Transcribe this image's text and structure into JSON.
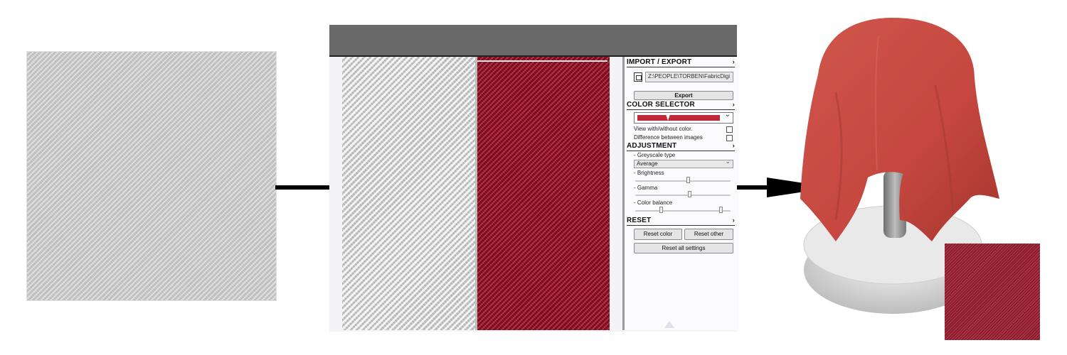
{
  "import_export": {
    "title": "IMPORT / EXPORT",
    "path_value": "Z:\\PEOPLE\\TORBEN\\FabricDigi",
    "export_label": "Export"
  },
  "color_selector": {
    "title": "COLOR SELECTOR",
    "swatch_color": "#c0283a",
    "view_with_without_label": "View with/without color.",
    "difference_label": "Difference between images"
  },
  "adjustment": {
    "title": "ADJUSTMENT",
    "greyscale_label": "- Greyscale type",
    "greyscale_value": "Average",
    "brightness_label": "- Brightness",
    "brightness_level": 0.5,
    "gamma_label": "- Gamma",
    "gamma_level": 0.55,
    "color_balance_label": "- Color balance",
    "color_balance_range": [
      0.2,
      0.9
    ]
  },
  "reset": {
    "title": "RESET",
    "reset_color_label": "Reset color",
    "reset_other_label": "Reset other",
    "reset_all_label": "Reset all settings"
  },
  "colors": {
    "fabric_red": "#b3112a",
    "cloth_render_red": "#c5473f",
    "titlebar_grey": "#6a6a6a"
  },
  "icons": {
    "chevron": "›",
    "dropdown": "⌄"
  }
}
